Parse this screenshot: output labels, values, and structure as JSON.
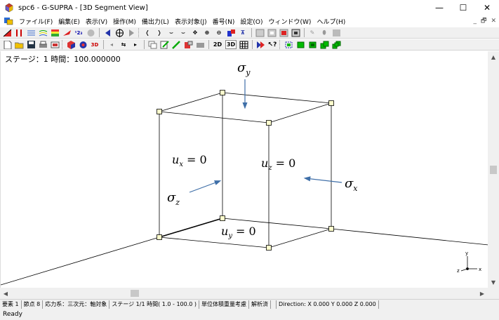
{
  "window": {
    "title": "spc6 - G-SUPRA - [3D Segment View]",
    "minimize": "—",
    "maximize": "☐",
    "close": "✕"
  },
  "menu": {
    "items": [
      "ファイル(F)",
      "編集(E)",
      "表示(V)",
      "操作(M)",
      "備出力(L)",
      "表示対象(J)",
      "番号(N)",
      "設定(O)",
      "ウィンドウ(W)",
      "ヘルプ(H)"
    ],
    "mdi_min": "_",
    "mdi_restore": "🗗",
    "mdi_close": "✕"
  },
  "toolbar2": {
    "label_2d": "2D",
    "label_3d": "3D"
  },
  "viewport": {
    "stage_info": "ステージ：1 時間：100.000000",
    "labels": {
      "sigma_y": "σ",
      "sigma_y_sub": "y",
      "sigma_x": "σ",
      "sigma_x_sub": "x",
      "sigma_z": "σ",
      "sigma_z_sub": "z",
      "ux": "u",
      "ux_sub": "x",
      "ux_eq": " = 0",
      "uz": "u",
      "uz_sub": "z",
      "uz_eq": " = 0",
      "uy": "u",
      "uy_sub": "y",
      "uy_eq": " = 0"
    },
    "axis": {
      "y": "y",
      "z": "z",
      "x": "x"
    }
  },
  "status": {
    "elements": "要素 1",
    "nodes": "節点 8",
    "stress": "応力系：三次元：軸対象",
    "stage": "ステージ 1/1 時間( 1.0 - 100.0 )",
    "unit_weight": "単位体積重量考慮",
    "analyzed": "解析済",
    "blank": "",
    "direction": "Direction: X 0.000 Y 0.000 Z 0.000"
  },
  "ready": "Ready",
  "colors": {
    "arrow": "#3f6fa8",
    "node_fill": "#ffffcc",
    "toolbar_bg": "#f0f0f0"
  }
}
